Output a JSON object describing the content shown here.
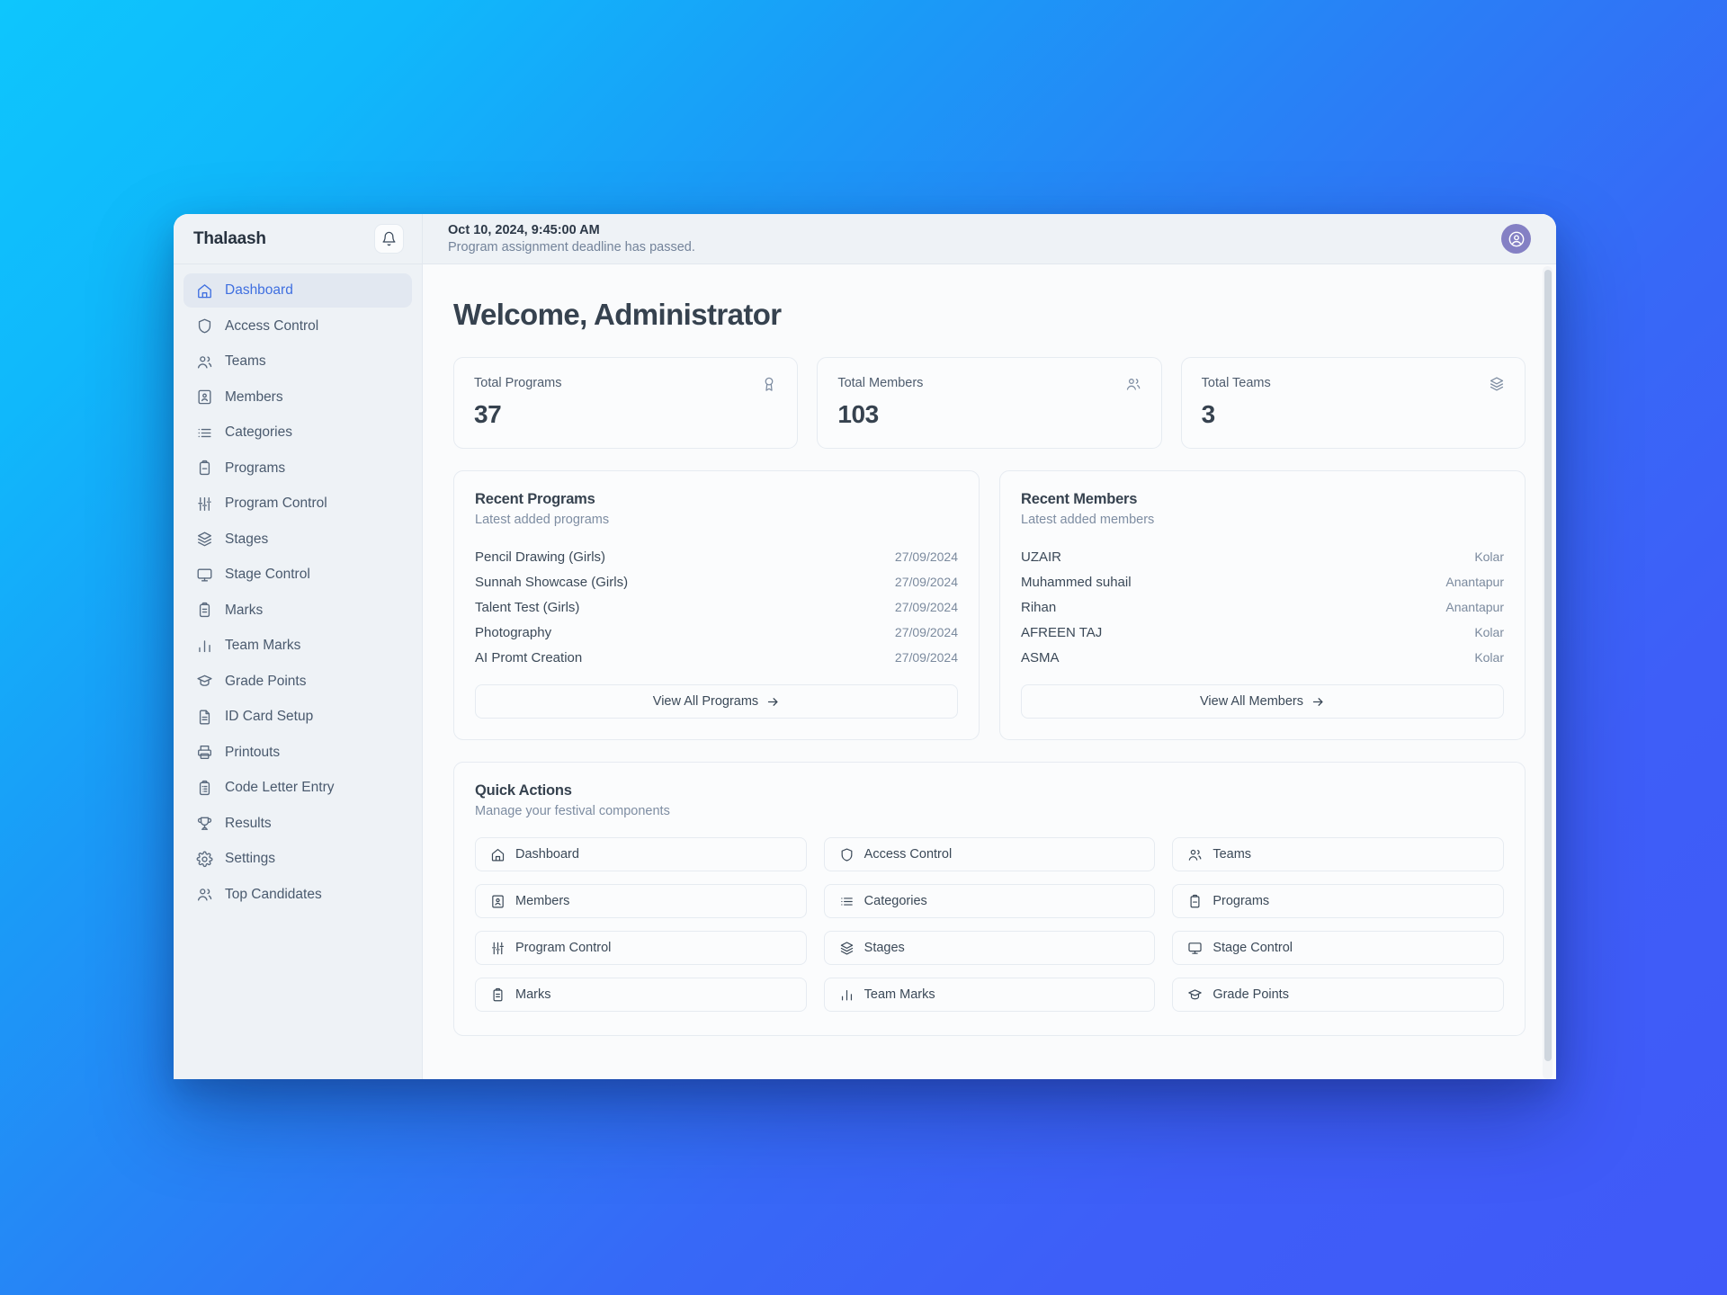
{
  "background": {
    "from": "#0ec6fd",
    "to": "#4059f8"
  },
  "accent": "#3f6fe0",
  "app": {
    "brand": "Thalaash",
    "notification_icon": "bell-icon",
    "avatar_icon": "user-circle-icon",
    "avatar_color": "#8480c4"
  },
  "sidebar": {
    "items": [
      {
        "label": "Dashboard",
        "icon": "home-icon",
        "active": true
      },
      {
        "label": "Access Control",
        "icon": "shield-icon",
        "active": false
      },
      {
        "label": "Teams",
        "icon": "users-icon",
        "active": false
      },
      {
        "label": "Members",
        "icon": "id-badge-icon",
        "active": false
      },
      {
        "label": "Categories",
        "icon": "list-icon",
        "active": false
      },
      {
        "label": "Programs",
        "icon": "clipboard-minus-icon",
        "active": false
      },
      {
        "label": "Program Control",
        "icon": "sliders-icon",
        "active": false
      },
      {
        "label": "Stages",
        "icon": "layers-icon",
        "active": false
      },
      {
        "label": "Stage Control",
        "icon": "monitor-icon",
        "active": false
      },
      {
        "label": "Marks",
        "icon": "clipboard-icon",
        "active": false
      },
      {
        "label": "Team Marks",
        "icon": "bar-chart-icon",
        "active": false
      },
      {
        "label": "Grade Points",
        "icon": "graduation-cap-icon",
        "active": false
      },
      {
        "label": "ID Card Setup",
        "icon": "file-text-icon",
        "active": false
      },
      {
        "label": "Printouts",
        "icon": "printer-icon",
        "active": false
      },
      {
        "label": "Code Letter Entry",
        "icon": "clipboard-list-icon",
        "active": false
      },
      {
        "label": "Results",
        "icon": "trophy-icon",
        "active": false
      },
      {
        "label": "Settings",
        "icon": "gear-icon",
        "active": false
      },
      {
        "label": "Top Candidates",
        "icon": "users-icon",
        "active": false
      }
    ]
  },
  "topbar": {
    "timestamp": "Oct 10, 2024, 9:45:00 AM",
    "notice": "Program assignment deadline has passed."
  },
  "main": {
    "page_title": "Welcome, Administrator",
    "stats": [
      {
        "label": "Total Programs",
        "value": "37",
        "icon": "award-icon"
      },
      {
        "label": "Total Members",
        "value": "103",
        "icon": "users-icon"
      },
      {
        "label": "Total Teams",
        "value": "3",
        "icon": "layers-icon"
      }
    ],
    "recent_programs": {
      "title": "Recent Programs",
      "subtitle": "Latest added programs",
      "rows": [
        {
          "name": "Pencil Drawing (Girls)",
          "meta": "27/09/2024"
        },
        {
          "name": "Sunnah Showcase (Girls)",
          "meta": "27/09/2024"
        },
        {
          "name": "Talent Test (Girls)",
          "meta": "27/09/2024"
        },
        {
          "name": "Photography",
          "meta": "27/09/2024"
        },
        {
          "name": "AI Promt Creation",
          "meta": "27/09/2024"
        }
      ],
      "button": "View All Programs"
    },
    "recent_members": {
      "title": "Recent Members",
      "subtitle": "Latest added members",
      "rows": [
        {
          "name": "UZAIR",
          "meta": "Kolar"
        },
        {
          "name": "Muhammed suhail",
          "meta": "Anantapur"
        },
        {
          "name": "Rihan",
          "meta": "Anantapur"
        },
        {
          "name": "AFREEN TAJ",
          "meta": "Kolar"
        },
        {
          "name": "ASMA",
          "meta": "Kolar"
        }
      ],
      "button": "View All Members"
    },
    "quick_actions": {
      "title": "Quick Actions",
      "subtitle": "Manage your festival components",
      "items": [
        {
          "label": "Dashboard",
          "icon": "home-icon"
        },
        {
          "label": "Access Control",
          "icon": "shield-icon"
        },
        {
          "label": "Teams",
          "icon": "users-icon"
        },
        {
          "label": "Members",
          "icon": "id-badge-icon"
        },
        {
          "label": "Categories",
          "icon": "list-icon"
        },
        {
          "label": "Programs",
          "icon": "clipboard-minus-icon"
        },
        {
          "label": "Program Control",
          "icon": "sliders-icon"
        },
        {
          "label": "Stages",
          "icon": "layers-icon"
        },
        {
          "label": "Stage Control",
          "icon": "monitor-icon"
        },
        {
          "label": "Marks",
          "icon": "clipboard-icon"
        },
        {
          "label": "Team Marks",
          "icon": "bar-chart-icon"
        },
        {
          "label": "Grade Points",
          "icon": "graduation-cap-icon"
        }
      ]
    }
  }
}
